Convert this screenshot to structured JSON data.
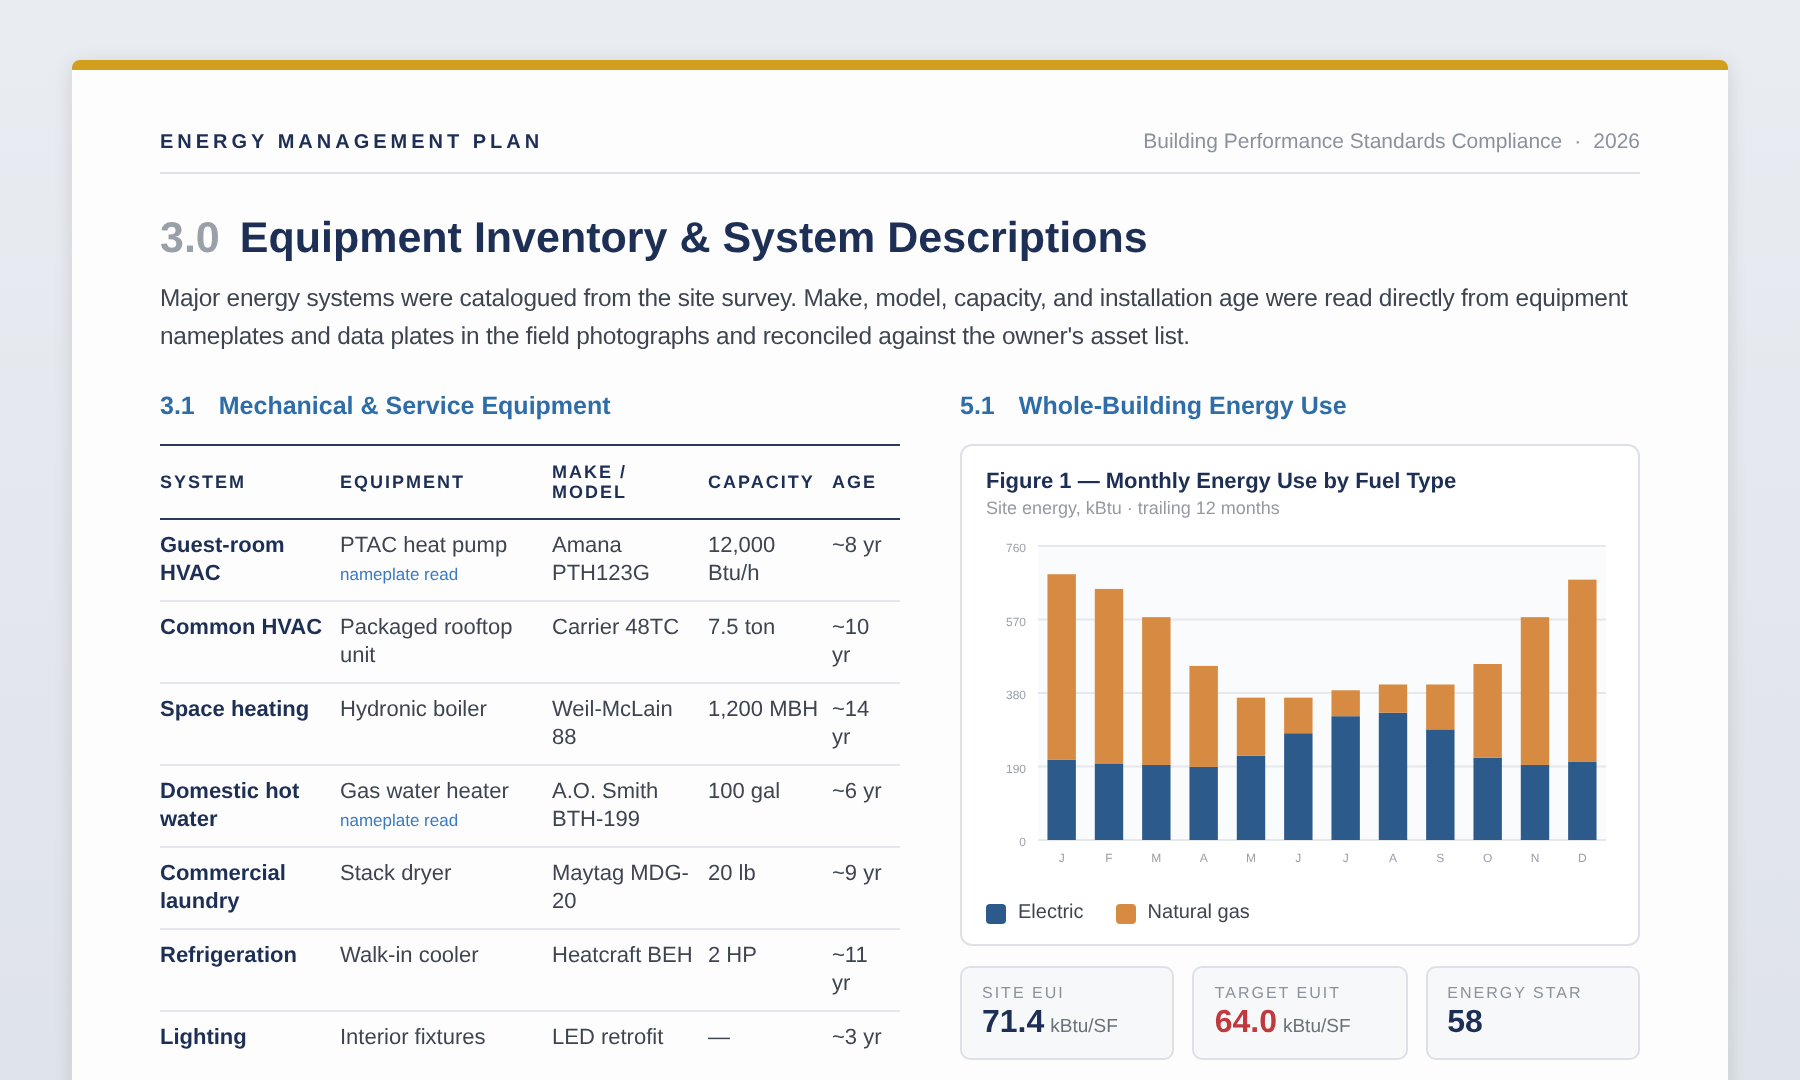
{
  "header": {
    "title": "ENERGY MANAGEMENT PLAN",
    "subtitle": "Building Performance Standards Compliance",
    "separator": "·",
    "year": "2026"
  },
  "section": {
    "number": "3.0",
    "title": "Equipment Inventory & System Descriptions",
    "intro": "Major energy systems were catalogued from the site survey. Make, model, capacity, and installation age were read directly from equipment nameplates and data plates in the field photographs and reconciled against the owner's asset list."
  },
  "table_section": {
    "number": "3.1",
    "title": "Mechanical & Service Equipment"
  },
  "table": {
    "columns": [
      "SYSTEM",
      "EQUIPMENT",
      "MAKE / MODEL",
      "CAPACITY",
      "AGE"
    ],
    "rows": [
      {
        "system": "Guest-room HVAC",
        "equipment": "PTAC heat pump",
        "note": "nameplate read",
        "model": "Amana PTH123G",
        "capacity": "12,000 Btu/h",
        "age": "~8 yr"
      },
      {
        "system": "Common HVAC",
        "equipment": "Packaged rooftop unit",
        "model": "Carrier 48TC",
        "capacity": "7.5 ton",
        "age": "~10 yr"
      },
      {
        "system": "Space heating",
        "equipment": "Hydronic boiler",
        "model": "Weil-McLain 88",
        "capacity": "1,200 MBH",
        "age": "~14 yr"
      },
      {
        "system": "Domestic hot water",
        "equipment": "Gas water heater",
        "note": "nameplate read",
        "model": "A.O. Smith BTH-199",
        "capacity": "100 gal",
        "age": "~6 yr"
      },
      {
        "system": "Commercial laundry",
        "equipment": "Stack dryer",
        "model": "Maytag MDG-20",
        "capacity": "20 lb",
        "age": "~9 yr"
      },
      {
        "system": "Refrigeration",
        "equipment": "Walk-in cooler",
        "model": "Heatcraft BEH",
        "capacity": "2 HP",
        "age": "~11 yr"
      },
      {
        "system": "Lighting",
        "equipment": "Interior fixtures",
        "model": "LED retrofit",
        "capacity": "—",
        "age": "~3 yr"
      }
    ]
  },
  "chart_section": {
    "number": "5.1",
    "title": "Whole-Building Energy Use"
  },
  "figure": {
    "title": "Figure 1 — Monthly Energy Use by Fuel Type",
    "subtitle": "Site energy, kBtu · trailing 12 months",
    "chart_data": {
      "type": "bar",
      "stacked": true,
      "grid": true,
      "categories": [
        "J",
        "F",
        "M",
        "A",
        "M",
        "J",
        "J",
        "A",
        "S",
        "O",
        "N",
        "D"
      ],
      "ylim": [
        0,
        760
      ],
      "yticks": [
        0,
        190,
        380,
        570,
        760
      ],
      "series": [
        {
          "name": "Electric",
          "color": "#2c5a8a",
          "values": [
            208,
            198,
            194,
            189,
            218,
            276,
            320,
            329,
            286,
            213,
            194,
            203
          ]
        },
        {
          "name": "Natural gas",
          "color": "#d68a42",
          "values": [
            479,
            451,
            382,
            261,
            150,
            92,
            67,
            73,
            116,
            242,
            382,
            470
          ]
        }
      ]
    }
  },
  "metrics": [
    {
      "label": "SITE EUI",
      "value": "71.4",
      "unit": "kBtu/SF",
      "kind": "normal"
    },
    {
      "label": "TARGET EUIT",
      "value": "64.0",
      "unit": "kBtu/SF",
      "kind": "alert"
    },
    {
      "label": "ENERGY STAR",
      "value": "58",
      "kind": "normal"
    }
  ]
}
